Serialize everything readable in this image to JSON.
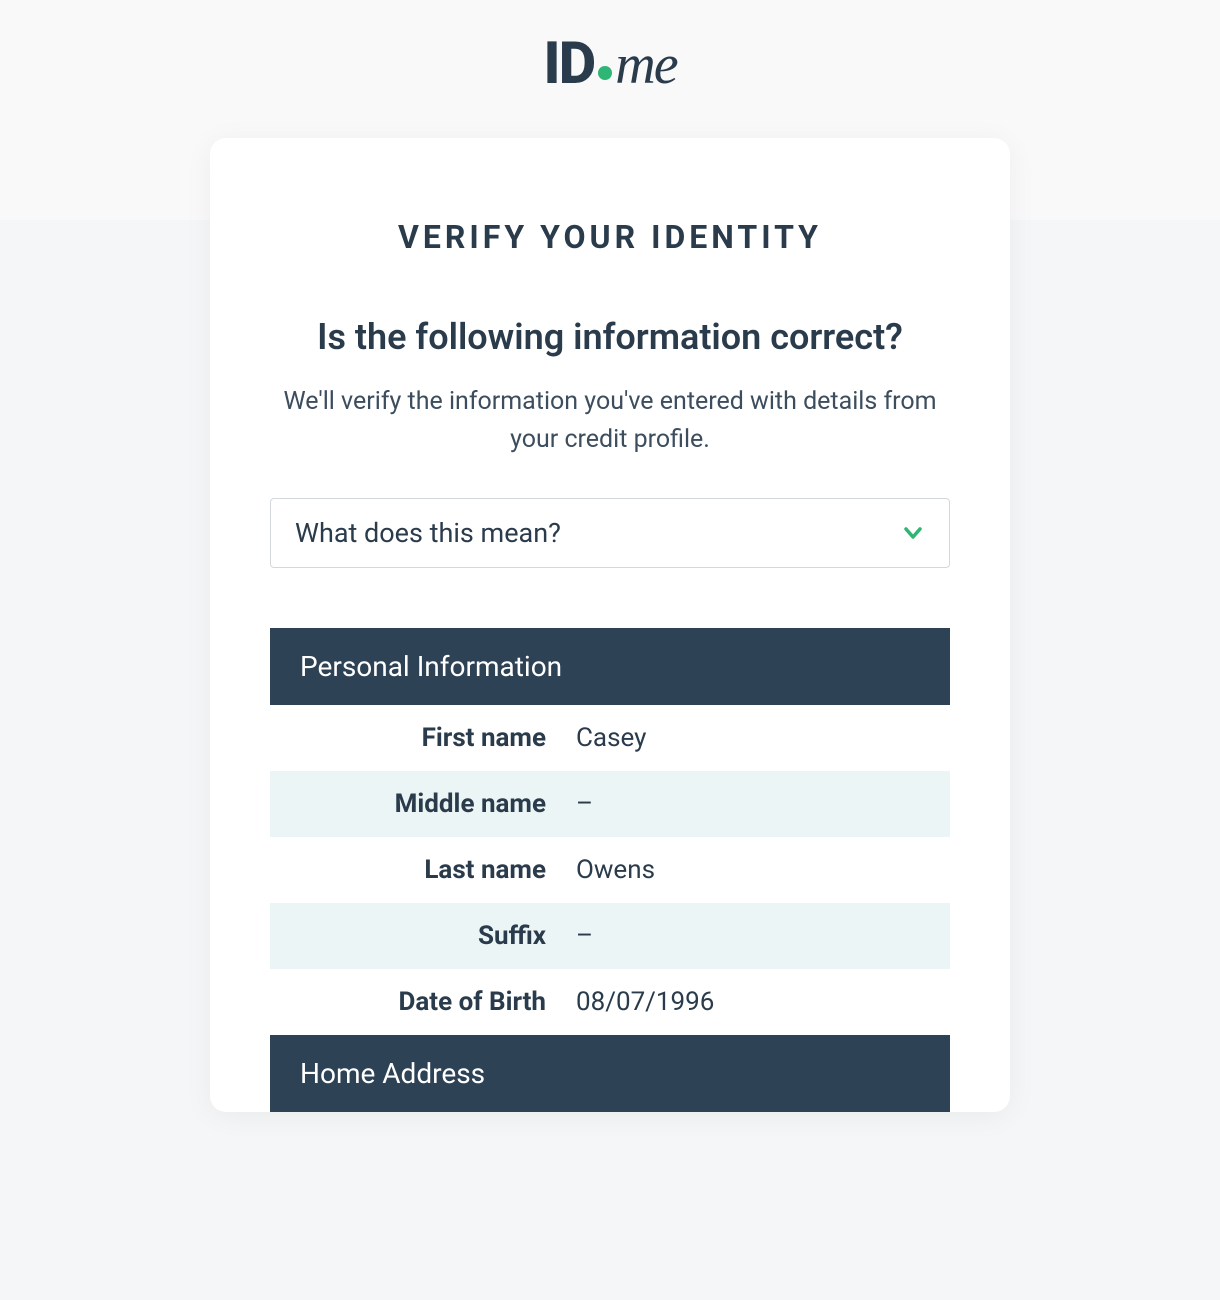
{
  "logo": {
    "text_id": "ID",
    "text_me": "me"
  },
  "header": {
    "verify_title": "VERIFY YOUR IDENTITY",
    "question": "Is the following information correct?",
    "subtitle": "We'll verify the information you've entered with details from your credit profile."
  },
  "accordion": {
    "label": "What does this mean?"
  },
  "sections": {
    "personal": {
      "title": "Personal Information",
      "rows": [
        {
          "label": "First name",
          "value": "Casey"
        },
        {
          "label": "Middle name",
          "value": "–"
        },
        {
          "label": "Last name",
          "value": "Owens"
        },
        {
          "label": "Suffix",
          "value": "–"
        },
        {
          "label": "Date of Birth",
          "value": "08/07/1996"
        }
      ]
    },
    "address": {
      "title": "Home Address"
    }
  },
  "colors": {
    "primary_dark": "#2a3b4c",
    "section_bg": "#2e4256",
    "accent_green": "#2fb574",
    "alt_row": "#ecf5f6"
  }
}
